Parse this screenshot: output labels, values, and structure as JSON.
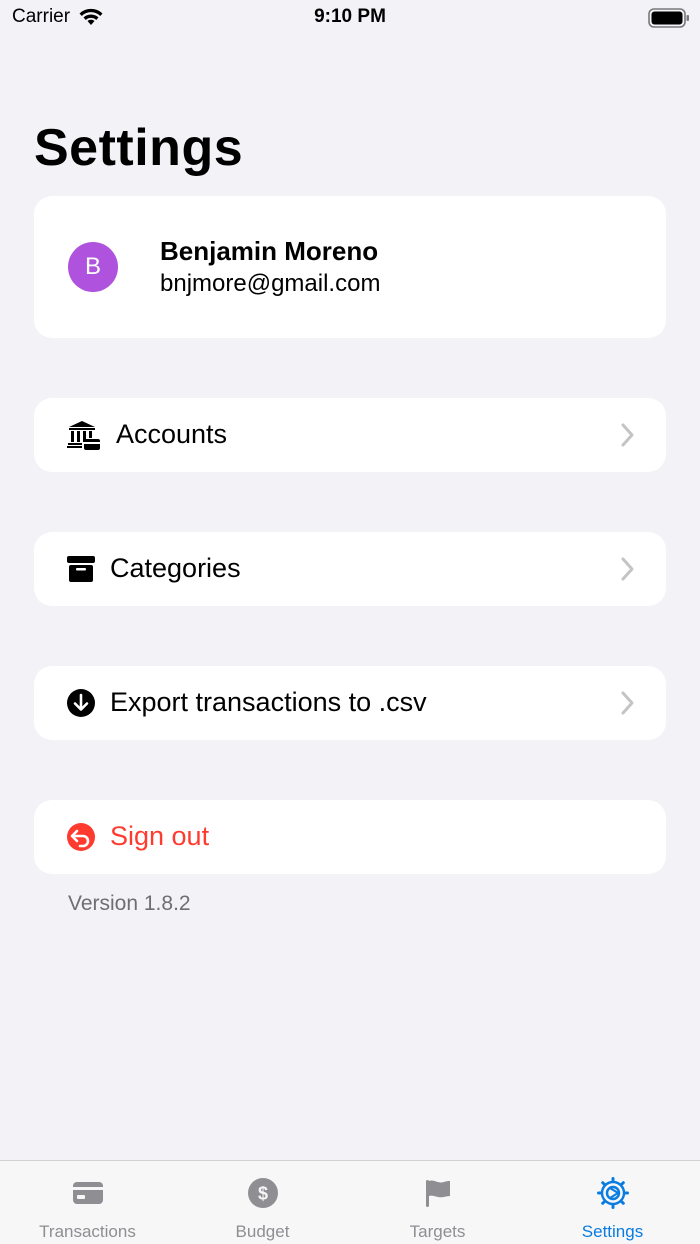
{
  "status_bar": {
    "carrier": "Carrier",
    "time": "9:10 PM"
  },
  "title": "Settings",
  "profile": {
    "initial": "B",
    "name": "Benjamin Moreno",
    "email": "bnjmore@gmail.com",
    "avatar_color": "#af52de"
  },
  "menu": {
    "accounts": {
      "label": "Accounts",
      "icon": "bank-icon"
    },
    "categories": {
      "label": "Categories",
      "icon": "archive-box-icon"
    },
    "export": {
      "label": "Export transactions to .csv",
      "icon": "download-circle-icon"
    },
    "signout": {
      "label": "Sign out",
      "icon": "sign-out-arrow-icon",
      "color": "#ff3b30"
    }
  },
  "version": "Version 1.8.2",
  "tabs": [
    {
      "label": "Transactions",
      "icon": "credit-card-icon"
    },
    {
      "label": "Budget",
      "icon": "dollar-circle-icon"
    },
    {
      "label": "Targets",
      "icon": "flag-icon"
    },
    {
      "label": "Settings",
      "icon": "gear-icon",
      "active": true
    }
  ],
  "colors": {
    "background": "#f2f2f7",
    "accent": "#0a7ce0",
    "destructive": "#ff3b30"
  }
}
